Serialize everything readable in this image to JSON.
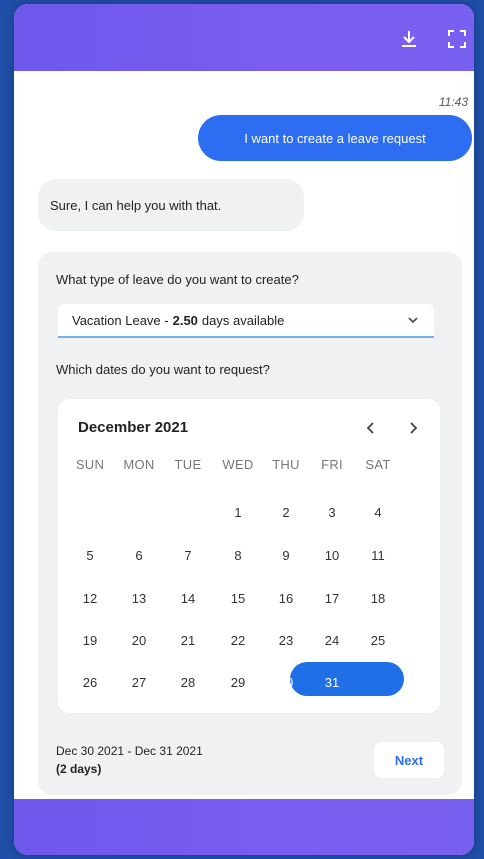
{
  "header": {
    "download_icon": "download-icon",
    "expand_icon": "expand-icon"
  },
  "chat": {
    "time": "11:43",
    "user_message": "I want to create a leave request",
    "bot_message": "Sure, I can help you with that."
  },
  "form": {
    "question_type": "What type of leave do you want to create?",
    "leave_select": {
      "prefix": "Vacation Leave -",
      "amount": "2.50",
      "suffix": "days available"
    },
    "question_dates": "Which dates do you want to request?"
  },
  "calendar": {
    "month_label": "December 2021",
    "weekdays": [
      "SUN",
      "MON",
      "TUE",
      "WED",
      "THU",
      "FRI",
      "SAT"
    ],
    "weeks": [
      [
        "",
        "",
        "",
        "1",
        "2",
        "3",
        "4"
      ],
      [
        "5",
        "6",
        "7",
        "8",
        "9",
        "10",
        "11"
      ],
      [
        "12",
        "13",
        "14",
        "15",
        "16",
        "17",
        "18"
      ],
      [
        "19",
        "20",
        "21",
        "22",
        "23",
        "24",
        "25"
      ],
      [
        "26",
        "27",
        "28",
        "29",
        "30",
        "31",
        ""
      ]
    ],
    "selected": [
      "30",
      "31"
    ]
  },
  "summary": {
    "range": "Dec 30 2021 - Dec 31 2021",
    "days": "(2 days)",
    "next_label": "Next"
  },
  "colors": {
    "accent": "#2d6df2",
    "header": "#7b5cf0",
    "selection": "#1f6fe6"
  }
}
